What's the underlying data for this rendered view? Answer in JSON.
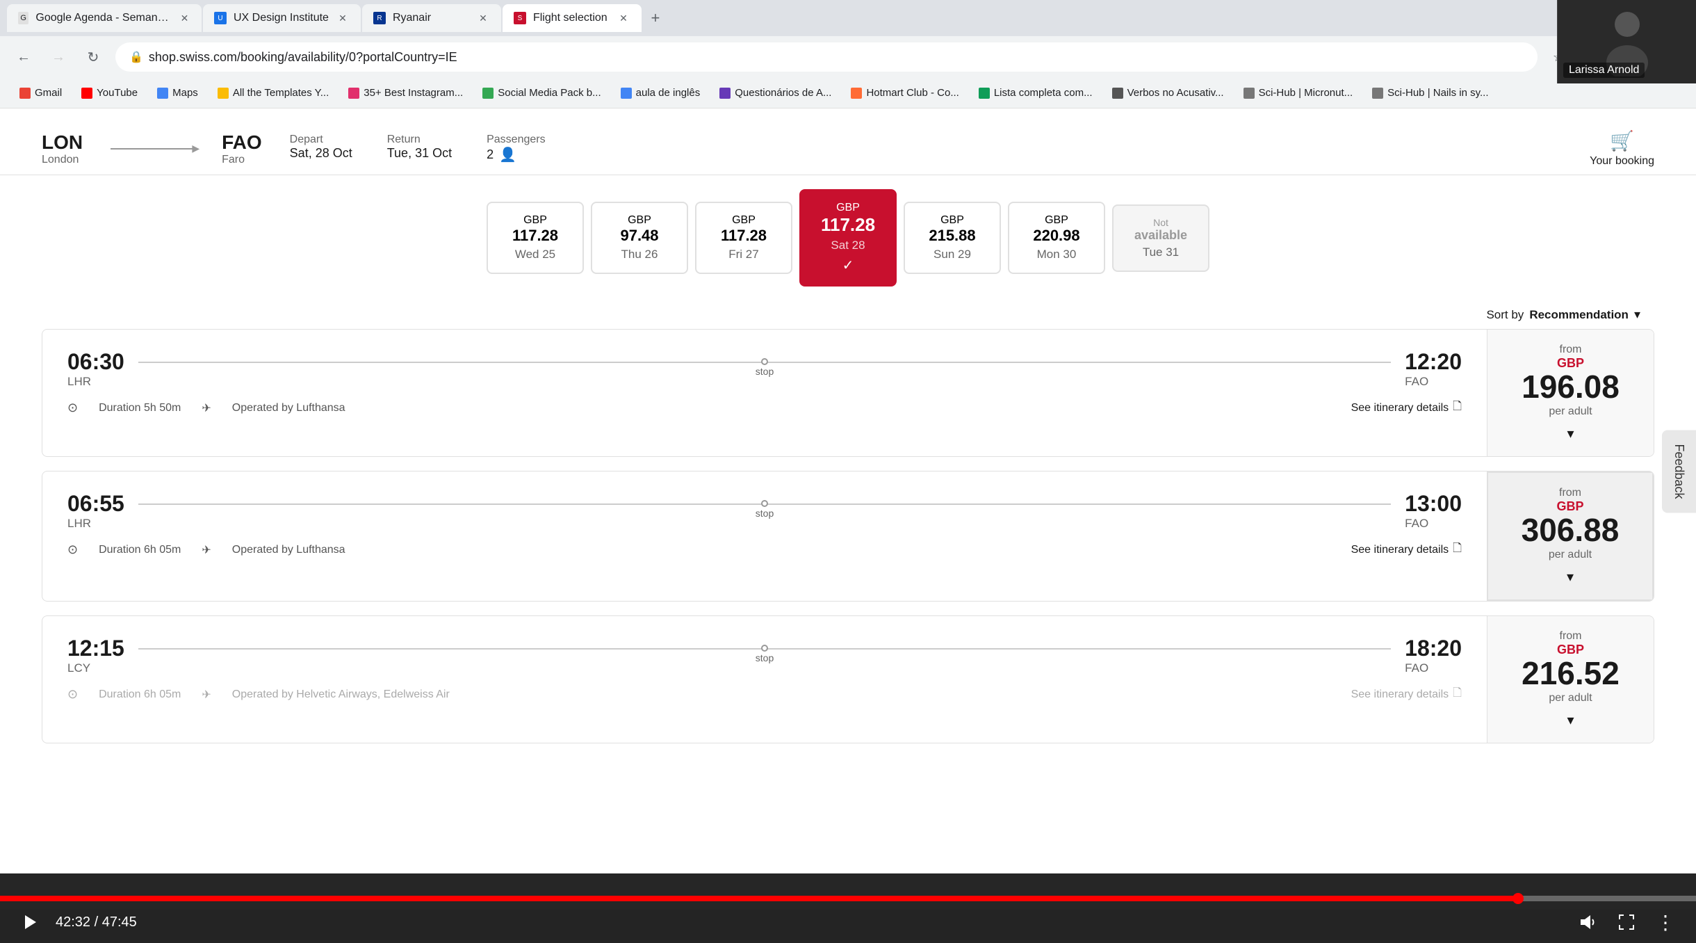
{
  "browser": {
    "tabs": [
      {
        "id": "tab1",
        "label": "Google Agenda - Semana de t...",
        "favicon": "G",
        "active": false
      },
      {
        "id": "tab2",
        "label": "UX Design Institute",
        "favicon": "U",
        "active": false
      },
      {
        "id": "tab3",
        "label": "Ryanair",
        "favicon": "R",
        "active": false
      },
      {
        "id": "tab4",
        "label": "Flight selection",
        "favicon": "F",
        "active": true
      }
    ],
    "address": "shop.swiss.com/booking/availability/0?portalCountry=IE",
    "bookmarks": [
      {
        "label": "Gmail",
        "favicon": "G"
      },
      {
        "label": "YouTube",
        "favicon": "▶"
      },
      {
        "label": "Maps",
        "favicon": "M"
      },
      {
        "label": "All the Templates Y...",
        "favicon": "A"
      },
      {
        "label": "35+ Best Instagram...",
        "favicon": "3"
      },
      {
        "label": "Social Media Pack b...",
        "favicon": "S"
      },
      {
        "label": "aula de inglês",
        "favicon": "a"
      },
      {
        "label": "Questionários de A...",
        "favicon": "Q"
      },
      {
        "label": "Hotmart Club - Co...",
        "favicon": "H"
      },
      {
        "label": "Lista completa com...",
        "favicon": "L"
      },
      {
        "label": "Verbos no Acusativ...",
        "favicon": "V"
      },
      {
        "label": "Sci-Hub | Micronut...",
        "favicon": "S"
      },
      {
        "label": "Sci-Hub | Nails in sy...",
        "favicon": "S"
      }
    ]
  },
  "flight_search": {
    "from_code": "LON",
    "from_name": "London",
    "to_code": "FAO",
    "to_name": "Faro",
    "depart_label": "Depart",
    "depart_date": "Sat, 28 Oct",
    "return_label": "Return",
    "return_date": "Tue, 31 Oct",
    "passengers_label": "Passengers",
    "passengers_count": "2",
    "your_booking": "Your booking"
  },
  "date_cards": [
    {
      "currency": "GBP",
      "price": "117.28",
      "day": "Wed 25",
      "selected": false,
      "unavailable": false
    },
    {
      "currency": "GBP",
      "price": "97.48",
      "day": "Thu 26",
      "selected": false,
      "unavailable": false
    },
    {
      "currency": "GBP",
      "price": "117.28",
      "day": "Fri 27",
      "selected": false,
      "unavailable": false
    },
    {
      "currency": "GBP",
      "price": "117.28",
      "day": "Sat 28",
      "selected": true,
      "unavailable": false
    },
    {
      "currency": "GBP",
      "price": "215.88",
      "day": "Sun 29",
      "selected": false,
      "unavailable": false
    },
    {
      "currency": "GBP",
      "price": "220.98",
      "day": "Mon 30",
      "selected": false,
      "unavailable": false
    },
    {
      "currency": "",
      "price": "Not available",
      "day": "Tue 31",
      "selected": false,
      "unavailable": true
    }
  ],
  "sort": {
    "label": "Sort by",
    "value": "Recommendation",
    "icon": "chevron-down"
  },
  "flights": [
    {
      "depart_time": "06:30",
      "depart_airport": "LHR",
      "arrive_time": "12:20",
      "arrive_airport": "FAO",
      "stop": "stop",
      "duration": "Duration  5h 50m",
      "operated": "Operated by  Lufthansa",
      "itinerary_link": "See itinerary details",
      "from_label": "from",
      "currency": "GBP",
      "price": "196.08",
      "per_adult": "per adult"
    },
    {
      "depart_time": "06:55",
      "depart_airport": "LHR",
      "arrive_time": "13:00",
      "arrive_airport": "FAO",
      "stop": "stop",
      "duration": "Duration  6h 05m",
      "operated": "Operated by  Lufthansa",
      "itinerary_link": "See itinerary details",
      "from_label": "from",
      "currency": "GBP",
      "price": "306.88",
      "per_adult": "per adult",
      "highlighted": true
    },
    {
      "depart_time": "12:15",
      "depart_airport": "LCY",
      "arrive_time": "18:20",
      "arrive_airport": "FAO",
      "stop": "stop",
      "duration": "Duration  6h 05m",
      "operated": "Operated by  Helvetic Airways, Edelweiss Air",
      "itinerary_link": "See itinerary details",
      "from_label": "from",
      "currency": "GBP",
      "price": "216.52",
      "per_adult": "per adult"
    }
  ],
  "video_controls": {
    "current_time": "42:32",
    "total_time": "47:45",
    "progress_percent": 89.5
  },
  "webcam": {
    "person_name": "Larissa Arnold"
  },
  "feedback": {
    "label": "Feedback"
  }
}
